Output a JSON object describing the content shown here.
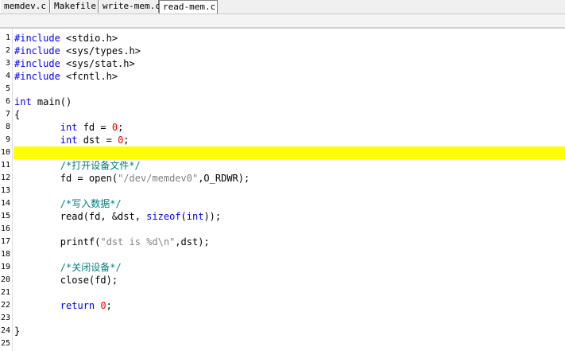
{
  "tabs": [
    "memdev.c",
    "Makefile",
    "write-mem.c",
    "read-mem.c"
  ],
  "active_tab": "read-mem.c",
  "highlight_line": 10,
  "lines": [
    {
      "n": "1",
      "parts": [
        [
          "kw",
          "#include"
        ],
        [
          "",
          ""
        ],
        [
          "",
          " <stdio.h>"
        ]
      ]
    },
    {
      "n": "2",
      "parts": [
        [
          "kw",
          "#include"
        ],
        [
          "",
          " <sys/types.h>"
        ]
      ]
    },
    {
      "n": "3",
      "parts": [
        [
          "kw",
          "#include"
        ],
        [
          "",
          " <sys/stat.h>"
        ]
      ]
    },
    {
      "n": "4",
      "parts": [
        [
          "kw",
          "#include"
        ],
        [
          "",
          " <fcntl.h>"
        ]
      ]
    },
    {
      "n": "5",
      "parts": []
    },
    {
      "n": "6",
      "parts": [
        [
          "kw",
          "int"
        ],
        [
          "",
          " main()"
        ]
      ]
    },
    {
      "n": "7",
      "parts": [
        [
          "",
          "{"
        ]
      ]
    },
    {
      "n": "8",
      "parts": [
        [
          "",
          "        "
        ],
        [
          "kw",
          "int"
        ],
        [
          "",
          " fd = "
        ],
        [
          "num",
          "0"
        ],
        [
          "",
          ";"
        ]
      ]
    },
    {
      "n": "9",
      "parts": [
        [
          "",
          "        "
        ],
        [
          "kw",
          "int"
        ],
        [
          "",
          " dst = "
        ],
        [
          "num",
          "0"
        ],
        [
          "",
          ";"
        ]
      ]
    },
    {
      "n": "10",
      "parts": []
    },
    {
      "n": "11",
      "parts": [
        [
          "",
          "        "
        ],
        [
          "cmt",
          "/*打开设备文件*/"
        ]
      ]
    },
    {
      "n": "12",
      "parts": [
        [
          "",
          "        fd = open("
        ],
        [
          "str",
          "\"/dev/memdev0\""
        ],
        [
          "",
          ",O_RDWR);"
        ]
      ]
    },
    {
      "n": "13",
      "parts": []
    },
    {
      "n": "14",
      "parts": [
        [
          "",
          "        "
        ],
        [
          "cmt",
          "/*写入数据*/"
        ]
      ]
    },
    {
      "n": "15",
      "parts": [
        [
          "",
          "        read(fd, &dst, "
        ],
        [
          "kw",
          "sizeof"
        ],
        [
          "",
          "("
        ],
        [
          "kw",
          "int"
        ],
        [
          "",
          "));"
        ]
      ]
    },
    {
      "n": "16",
      "parts": []
    },
    {
      "n": "17",
      "parts": [
        [
          "",
          "        printf("
        ],
        [
          "str",
          "\"dst is %d\\n\""
        ],
        [
          "",
          ",dst);"
        ]
      ]
    },
    {
      "n": "18",
      "parts": []
    },
    {
      "n": "19",
      "parts": [
        [
          "",
          "        "
        ],
        [
          "cmt",
          "/*关闭设备*/"
        ]
      ]
    },
    {
      "n": "20",
      "parts": [
        [
          "",
          "        close(fd);"
        ]
      ]
    },
    {
      "n": "21",
      "parts": []
    },
    {
      "n": "22",
      "parts": [
        [
          "",
          "        "
        ],
        [
          "kw",
          "return"
        ],
        [
          "",
          " "
        ],
        [
          "num",
          "0"
        ],
        [
          "",
          ";"
        ]
      ]
    },
    {
      "n": "23",
      "parts": []
    },
    {
      "n": "24",
      "parts": [
        [
          "",
          "}"
        ]
      ]
    },
    {
      "n": "25",
      "parts": []
    }
  ]
}
